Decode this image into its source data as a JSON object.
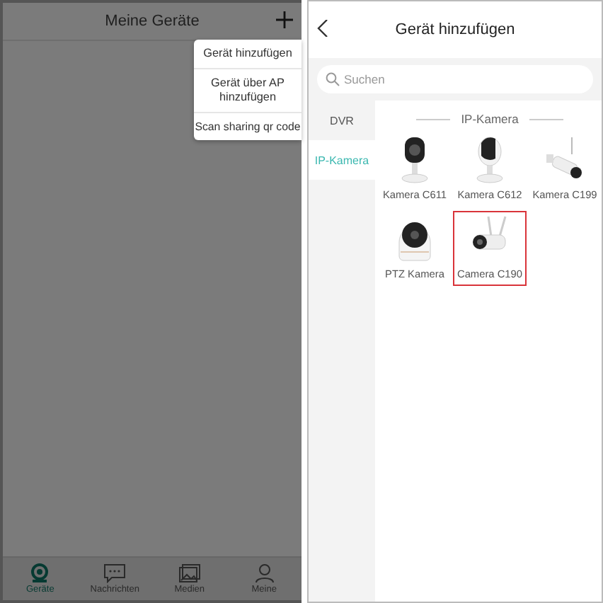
{
  "left_screen": {
    "title": "Meine Geräte",
    "menu": [
      {
        "label": "Gerät hinzufügen"
      },
      {
        "label": "Gerät über AP hinzufügen"
      },
      {
        "label": "Scan sharing qr code"
      }
    ],
    "tabs": [
      {
        "label": "Geräte",
        "kind": "camera",
        "selected": true
      },
      {
        "label": "Nachrichten",
        "kind": "message",
        "selected": false
      },
      {
        "label": "Medien",
        "kind": "media",
        "selected": false
      },
      {
        "label": "Meine",
        "kind": "person",
        "selected": false
      }
    ]
  },
  "right_screen": {
    "title": "Gerät hinzufügen",
    "search": {
      "placeholder": "Suchen"
    },
    "categories": [
      {
        "label": "DVR",
        "selected": false
      },
      {
        "label": "IP-Kamera",
        "selected": true
      }
    ],
    "section_title": "IP-Kamera",
    "devices": [
      {
        "name": "Kamera C611",
        "kind": "cube",
        "selected": false
      },
      {
        "name": "Kamera C612",
        "kind": "dome",
        "selected": false
      },
      {
        "name": "Kamera C199",
        "kind": "bullet",
        "selected": false
      },
      {
        "name": "PTZ Kamera",
        "kind": "ptz",
        "selected": false
      },
      {
        "name": "Camera C190",
        "kind": "antenna",
        "selected": true
      }
    ]
  }
}
